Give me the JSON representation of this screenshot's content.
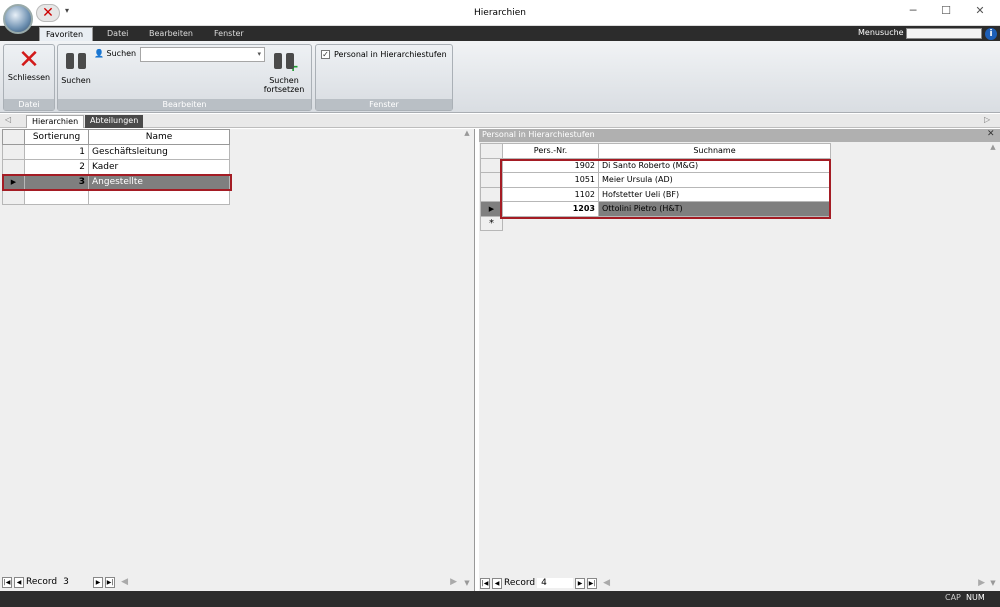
{
  "window": {
    "title": "Hierarchien"
  },
  "ribbon_tabs": [
    "Favoriten",
    "Datei",
    "Bearbeiten",
    "Fenster"
  ],
  "menusuche_label": "Menusuche",
  "groups": {
    "datei": {
      "label": "Datei",
      "close_label": "Schliessen"
    },
    "bearbeiten": {
      "label": "Bearbeiten",
      "search_label": "Suchen",
      "search_field_label": "Suchen",
      "continue_label_1": "Suchen",
      "continue_label_2": "fortsetzen"
    },
    "fenster": {
      "label": "Fenster",
      "checkbox_label": "Personal in Hierarchiestufen",
      "checked": true
    }
  },
  "doc_tabs": [
    "Hierarchien",
    "Abteilungen"
  ],
  "left_grid": {
    "headers": [
      "Sortierung",
      "Name"
    ],
    "rows": [
      {
        "sort": "1",
        "name": "Geschäftsleitung"
      },
      {
        "sort": "2",
        "name": "Kader"
      },
      {
        "sort": "3",
        "name": "Angestellte"
      }
    ],
    "record_label": "Record",
    "record_value": "3"
  },
  "right_panel": {
    "title": "Personal in Hierarchiestufen",
    "headers": [
      "Pers.-Nr.",
      "Suchname"
    ],
    "rows": [
      {
        "nr": "1902",
        "name": "Di Santo Roberto (M&G)"
      },
      {
        "nr": "1051",
        "name": "Meier Ursula (AD)"
      },
      {
        "nr": "1102",
        "name": "Hofstetter Ueli (BF)"
      },
      {
        "nr": "1203",
        "name": "Ottolini Pietro (H&T)"
      }
    ],
    "record_label": "Record",
    "record_value": "4"
  },
  "status": {
    "cap": "CAP",
    "num": "NUM"
  },
  "colors": {
    "accent_red": "#a41c24",
    "tabbar": "#2c2c2c"
  }
}
